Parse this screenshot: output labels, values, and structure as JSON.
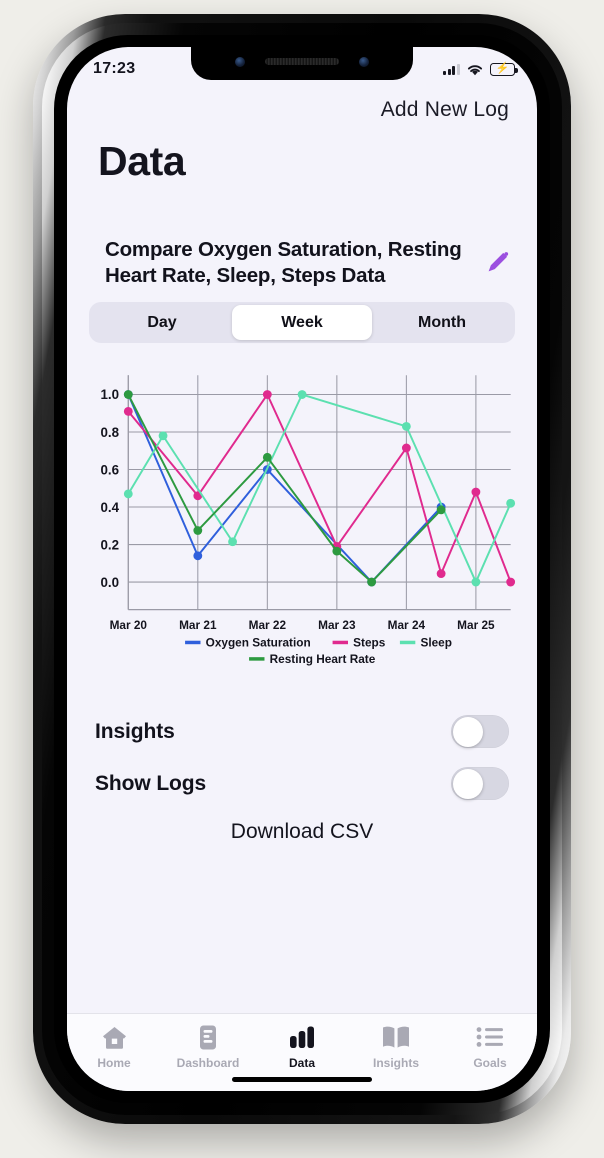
{
  "status_bar": {
    "time": "17:23",
    "signal_icon": "cellular-bars-icon",
    "wifi_icon": "wifi-icon",
    "battery_icon": "battery-charging-icon"
  },
  "header": {
    "add_log_label": "Add New Log",
    "page_title": "Data"
  },
  "card": {
    "title": "Compare Oxygen Saturation, Resting Heart Rate, Sleep, Steps Data",
    "edit_icon": "pencil-icon",
    "edit_icon_color": "#9b4fe0",
    "segments": [
      {
        "label": "Day",
        "active": false
      },
      {
        "label": "Week",
        "active": true
      },
      {
        "label": "Month",
        "active": false
      }
    ]
  },
  "settings": {
    "rows": [
      {
        "label": "Insights",
        "on": false
      },
      {
        "label": "Show Logs",
        "on": false
      }
    ],
    "download_label": "Download CSV"
  },
  "tabbar": {
    "items": [
      {
        "label": "Home",
        "icon": "home-icon",
        "active": false
      },
      {
        "label": "Dashboard",
        "icon": "dashboard-icon",
        "active": false
      },
      {
        "label": "Data",
        "icon": "bar-chart-icon",
        "active": true
      },
      {
        "label": "Insights",
        "icon": "book-icon",
        "active": false
      },
      {
        "label": "Goals",
        "icon": "list-icon",
        "active": false
      }
    ]
  },
  "chart_data": {
    "type": "line",
    "title": "",
    "xlabel": "",
    "ylabel": "",
    "ylim": [
      -0.07,
      1.07
    ],
    "yticks": [
      0.0,
      0.2,
      0.4,
      0.6,
      0.8,
      1.0
    ],
    "ytick_labels": [
      "0.0",
      "0.2",
      "0.4",
      "0.6",
      "0.8",
      "1.0"
    ],
    "grid": true,
    "legend_position": "below",
    "x": [
      0,
      1,
      2,
      3,
      4,
      5,
      6,
      7,
      8,
      9,
      10,
      11
    ],
    "xtick_positions": [
      0,
      2,
      4,
      6,
      8,
      10
    ],
    "categories": [
      "Mar 20",
      "Mar 21",
      "Mar 22",
      "Mar 23",
      "Mar 24",
      "Mar 25"
    ],
    "series": [
      {
        "name": "Oxygen Saturation",
        "color": "#2f5fdc",
        "points": [
          {
            "x": 0,
            "y": 1.0
          },
          {
            "x": 2,
            "y": 0.14
          },
          {
            "x": 4,
            "y": 0.6
          },
          {
            "x": 7,
            "y": 0.0
          },
          {
            "x": 9,
            "y": 0.4
          }
        ]
      },
      {
        "name": "Steps",
        "color": "#e02a8e",
        "points": [
          {
            "x": 0,
            "y": 0.91
          },
          {
            "x": 2,
            "y": 0.46
          },
          {
            "x": 4,
            "y": 1.0
          },
          {
            "x": 6,
            "y": 0.19
          },
          {
            "x": 8,
            "y": 0.715
          },
          {
            "x": 9,
            "y": 0.045
          },
          {
            "x": 10,
            "y": 0.48
          },
          {
            "x": 11,
            "y": 0.0
          }
        ]
      },
      {
        "name": "Sleep",
        "color": "#5ce0b0",
        "points": [
          {
            "x": 0,
            "y": 0.47
          },
          {
            "x": 1,
            "y": 0.78
          },
          {
            "x": 3,
            "y": 0.215
          },
          {
            "x": 5,
            "y": 1.0
          },
          {
            "x": 8,
            "y": 0.83
          },
          {
            "x": 10,
            "y": 0.0
          },
          {
            "x": 11,
            "y": 0.42
          }
        ]
      },
      {
        "name": "Resting Heart Rate",
        "color": "#2d9a40",
        "points": [
          {
            "x": 0,
            "y": 1.0
          },
          {
            "x": 2,
            "y": 0.275
          },
          {
            "x": 4,
            "y": 0.665
          },
          {
            "x": 6,
            "y": 0.165
          },
          {
            "x": 7,
            "y": 0.0
          },
          {
            "x": 9,
            "y": 0.385
          }
        ]
      }
    ]
  }
}
